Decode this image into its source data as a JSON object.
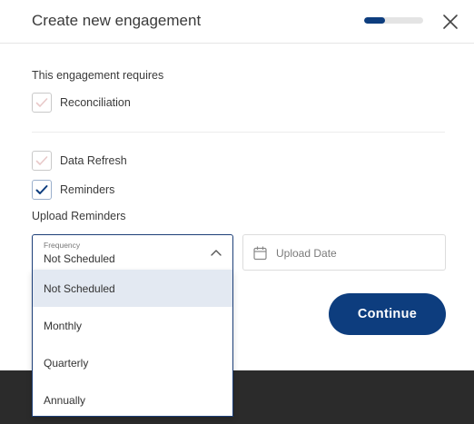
{
  "modal": {
    "title": "Create new engagement",
    "progress_fraction": 0.35,
    "colors": {
      "accent": "#0d3d7e",
      "overlay": "#2b2b2b"
    }
  },
  "requirements": {
    "heading": "This engagement requires",
    "reconciliation": {
      "label": "Reconciliation",
      "checked": false
    },
    "data_refresh": {
      "label": "Data Refresh",
      "checked": false
    },
    "reminders": {
      "label": "Reminders",
      "checked": true
    }
  },
  "upload_reminders": {
    "label": "Upload Reminders",
    "frequency": {
      "caption": "Frequency",
      "value": "Not Scheduled",
      "options": [
        "Not Scheduled",
        "Monthly",
        "Quarterly",
        "Annually"
      ]
    },
    "upload_date": {
      "placeholder": "Upload Date",
      "icon": "calendar-icon"
    }
  },
  "actions": {
    "continue_label": "Continue"
  }
}
